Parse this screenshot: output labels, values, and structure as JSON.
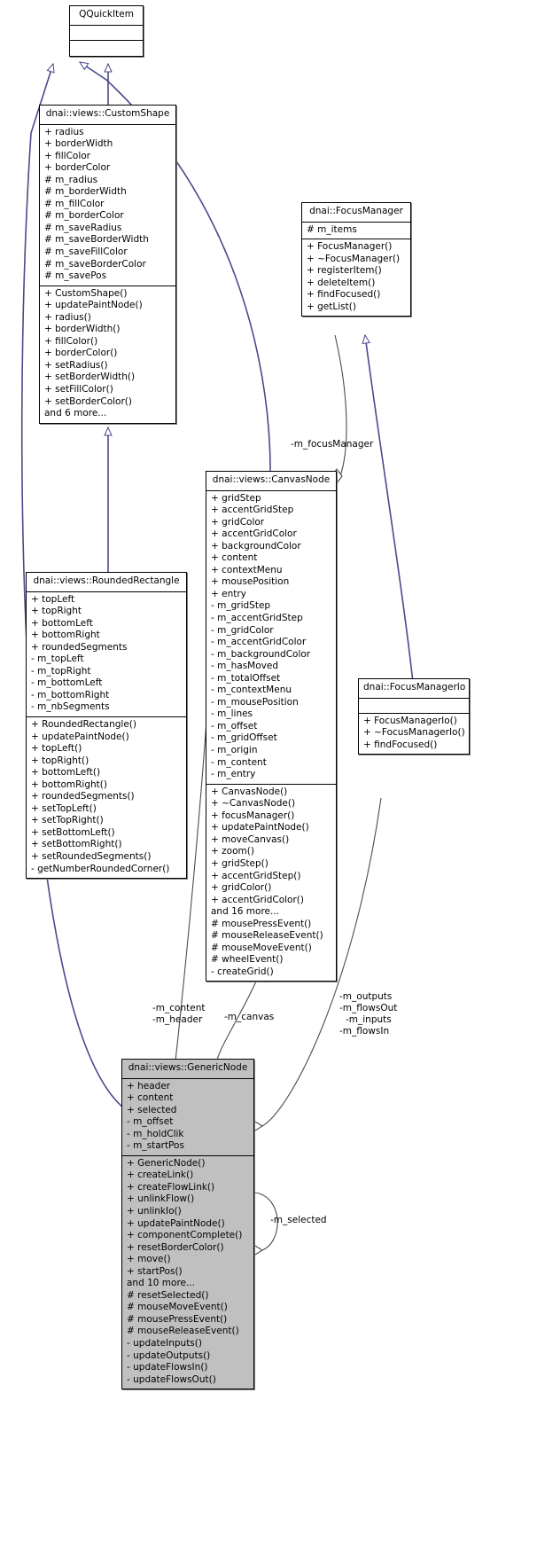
{
  "diagram": {
    "kind": "uml-class-diagram",
    "colors": {
      "inheritance_edge": "#4a4a8c",
      "association_edge": "#4d4d4d",
      "box_border": "#000000",
      "box_fill": "#ffffff",
      "highlight_fill": "#c0c0c0",
      "text": "#000000"
    }
  },
  "classes": {
    "qquickitem": {
      "name": "QQuickItem",
      "attributes": [],
      "methods": [],
      "highlight": false
    },
    "customshape": {
      "name": "dnai::views::CustomShape",
      "attributes": [
        "+ radius",
        "+ borderWidth",
        "+ fillColor",
        "+ borderColor",
        "# m_radius",
        "# m_borderWidth",
        "# m_fillColor",
        "# m_borderColor",
        "# m_saveRadius",
        "# m_saveBorderWidth",
        "# m_saveFillColor",
        "# m_saveBorderColor",
        "# m_savePos"
      ],
      "methods": [
        "+ CustomShape()",
        "+ updatePaintNode()",
        "+ radius()",
        "+ borderWidth()",
        "+ fillColor()",
        "+ borderColor()",
        "+ setRadius()",
        "+ setBorderWidth()",
        "+ setFillColor()",
        "+ setBorderColor()",
        "and 6 more..."
      ],
      "highlight": false
    },
    "focusmanager": {
      "name": "dnai::FocusManager",
      "attributes": [
        "# m_items"
      ],
      "methods": [
        "+ FocusManager()",
        "+ ~FocusManager()",
        "+ registerItem()",
        "+ deleteItem()",
        "+ findFocused()",
        "+ getList()"
      ],
      "highlight": false
    },
    "roundedrectangle": {
      "name": "dnai::views::RoundedRectangle",
      "attributes": [
        "+ topLeft",
        "+ topRight",
        "+ bottomLeft",
        "+ bottomRight",
        "+ roundedSegments",
        "- m_topLeft",
        "- m_topRight",
        "- m_bottomLeft",
        "- m_bottomRight",
        "- m_nbSegments"
      ],
      "methods": [
        "+ RoundedRectangle()",
        "+ updatePaintNode()",
        "+ topLeft()",
        "+ topRight()",
        "+ bottomLeft()",
        "+ bottomRight()",
        "+ roundedSegments()",
        "+ setTopLeft()",
        "+ setTopRight()",
        "+ setBottomLeft()",
        "+ setBottomRight()",
        "+ setRoundedSegments()",
        "- getNumberRoundedCorner()"
      ],
      "highlight": false
    },
    "canvasnode": {
      "name": "dnai::views::CanvasNode",
      "attributes": [
        "+ gridStep",
        "+ accentGridStep",
        "+ gridColor",
        "+ accentGridColor",
        "+ backgroundColor",
        "+ content",
        "+ contextMenu",
        "+ mousePosition",
        "+ entry",
        "- m_gridStep",
        "- m_accentGridStep",
        "- m_gridColor",
        "- m_accentGridColor",
        "- m_backgroundColor",
        "- m_hasMoved",
        "- m_totalOffset",
        "- m_contextMenu",
        "- m_mousePosition",
        "- m_lines",
        "- m_offset",
        "- m_gridOffset",
        "- m_origin",
        "- m_content",
        "- m_entry"
      ],
      "methods": [
        "+ CanvasNode()",
        "+ ~CanvasNode()",
        "+ focusManager()",
        "+ updatePaintNode()",
        "+ moveCanvas()",
        "+ zoom()",
        "+ gridStep()",
        "+ accentGridStep()",
        "+ gridColor()",
        "+ accentGridColor()",
        "and 16 more...",
        "# mousePressEvent()",
        "# mouseReleaseEvent()",
        "# mouseMoveEvent()",
        "# wheelEvent()",
        "- createGrid()"
      ],
      "highlight": false
    },
    "focusmanagerio": {
      "name": "dnai::FocusManagerIo",
      "attributes": [],
      "methods": [
        "+ FocusManagerIo()",
        "+ ~FocusManagerIo()",
        "+ findFocused()"
      ],
      "highlight": false
    },
    "genericnode": {
      "name": "dnai::views::GenericNode",
      "attributes": [
        "+ header",
        "+ content",
        "+ selected",
        "- m_offset",
        "- m_holdClik",
        "- m_startPos"
      ],
      "methods": [
        "+ GenericNode()",
        "+ createLink()",
        "+ createFlowLink()",
        "+ unlinkFlow()",
        "+ unlinkIo()",
        "+ updatePaintNode()",
        "+ componentComplete()",
        "+ resetBorderColor()",
        "+ move()",
        "+ startPos()",
        "and 10 more...",
        "# resetSelected()",
        "# mouseMoveEvent()",
        "# mousePressEvent()",
        "# mouseReleaseEvent()",
        "- updateInputs()",
        "- updateOutputs()",
        "- updateFlowsIn()",
        "- updateFlowsOut()"
      ],
      "highlight": true
    }
  },
  "edge_labels": {
    "focus_manager": "-m_focusManager",
    "content": "-m_content",
    "header": "-m_header",
    "canvas": "-m_canvas",
    "outputs": "-m_outputs",
    "flows_out": "-m_flowsOut",
    "inputs": "-m_inputs",
    "flows_in": "-m_flowsIn",
    "selected": "-m_selected"
  }
}
